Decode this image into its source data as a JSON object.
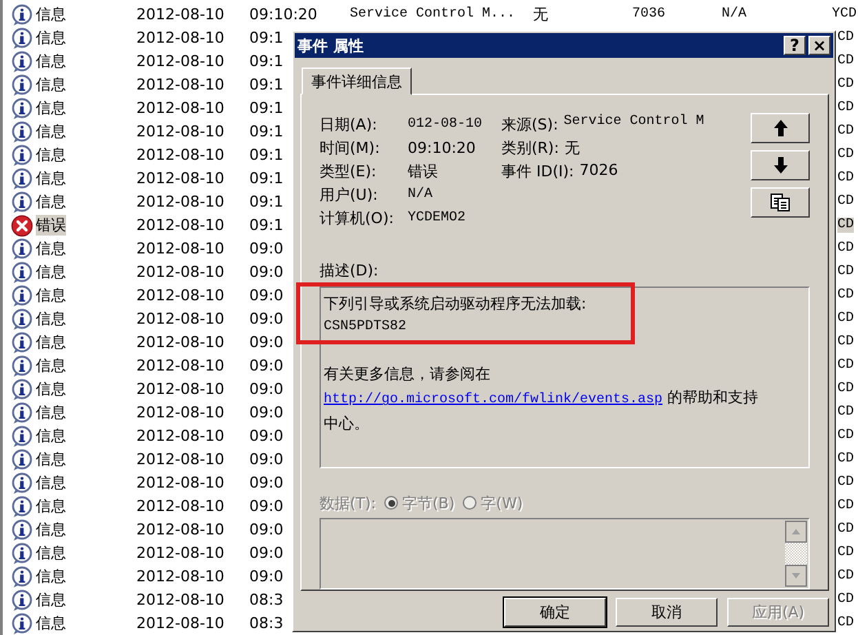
{
  "event_list": {
    "rows": [
      {
        "kind": "info",
        "type": "信息",
        "date": "2012-08-10",
        "time": "09:10:20",
        "source": "Service Control M...",
        "category": "无",
        "event_id": "7036",
        "user": "N/A",
        "computer": "YCD",
        "selected": false
      },
      {
        "kind": "info",
        "type": "信息",
        "date": "2012-08-10",
        "time": "09:1",
        "computer": "CD",
        "selected": false
      },
      {
        "kind": "info",
        "type": "信息",
        "date": "2012-08-10",
        "time": "09:1",
        "computer": "CD",
        "selected": false
      },
      {
        "kind": "info",
        "type": "信息",
        "date": "2012-08-10",
        "time": "09:1",
        "computer": "CD",
        "selected": false
      },
      {
        "kind": "info",
        "type": "信息",
        "date": "2012-08-10",
        "time": "09:1",
        "computer": "CD",
        "selected": false
      },
      {
        "kind": "info",
        "type": "信息",
        "date": "2012-08-10",
        "time": "09:1",
        "computer": "CD",
        "selected": false
      },
      {
        "kind": "info",
        "type": "信息",
        "date": "2012-08-10",
        "time": "09:1",
        "computer": "CD",
        "selected": false
      },
      {
        "kind": "info",
        "type": "信息",
        "date": "2012-08-10",
        "time": "09:1",
        "computer": "CD",
        "selected": false
      },
      {
        "kind": "info",
        "type": "信息",
        "date": "2012-08-10",
        "time": "09:1",
        "computer": "CD",
        "selected": false
      },
      {
        "kind": "error",
        "type": "错误",
        "date": "2012-08-10",
        "time": "09:1",
        "computer": "CD",
        "selected": true
      },
      {
        "kind": "info",
        "type": "信息",
        "date": "2012-08-10",
        "time": "09:0",
        "computer": "CD",
        "selected": false
      },
      {
        "kind": "info",
        "type": "信息",
        "date": "2012-08-10",
        "time": "09:0",
        "computer": "CD",
        "selected": false
      },
      {
        "kind": "info",
        "type": "信息",
        "date": "2012-08-10",
        "time": "09:0",
        "computer": "CD",
        "selected": false
      },
      {
        "kind": "info",
        "type": "信息",
        "date": "2012-08-10",
        "time": "09:0",
        "computer": "CD",
        "selected": false
      },
      {
        "kind": "info",
        "type": "信息",
        "date": "2012-08-10",
        "time": "09:0",
        "computer": "CD",
        "selected": false
      },
      {
        "kind": "info",
        "type": "信息",
        "date": "2012-08-10",
        "time": "09:0",
        "computer": "CD",
        "selected": false
      },
      {
        "kind": "info",
        "type": "信息",
        "date": "2012-08-10",
        "time": "09:0",
        "computer": "CD",
        "selected": false
      },
      {
        "kind": "info",
        "type": "信息",
        "date": "2012-08-10",
        "time": "09:0",
        "computer": "CD",
        "selected": false
      },
      {
        "kind": "info",
        "type": "信息",
        "date": "2012-08-10",
        "time": "09:0",
        "computer": "CD",
        "selected": false
      },
      {
        "kind": "info",
        "type": "信息",
        "date": "2012-08-10",
        "time": "09:0",
        "computer": "CD",
        "selected": false
      },
      {
        "kind": "info",
        "type": "信息",
        "date": "2012-08-10",
        "time": "09:0",
        "computer": "CD",
        "selected": false
      },
      {
        "kind": "info",
        "type": "信息",
        "date": "2012-08-10",
        "time": "09:0",
        "computer": "CD",
        "selected": false
      },
      {
        "kind": "info",
        "type": "信息",
        "date": "2012-08-10",
        "time": "09:0",
        "computer": "CD",
        "selected": false
      },
      {
        "kind": "info",
        "type": "信息",
        "date": "2012-08-10",
        "time": "09:0",
        "computer": "CD",
        "selected": false
      },
      {
        "kind": "info",
        "type": "信息",
        "date": "2012-08-10",
        "time": "09:0",
        "computer": "CD",
        "selected": false
      },
      {
        "kind": "info",
        "type": "信息",
        "date": "2012-08-10",
        "time": "08:3",
        "computer": "CD",
        "selected": false
      },
      {
        "kind": "info",
        "type": "信息",
        "date": "2012-08-10",
        "time": "08:3",
        "computer": "CD",
        "selected": false
      }
    ]
  },
  "dialog": {
    "title": "事件 属性",
    "help_button": "?",
    "close_button": "×",
    "tabs": [
      {
        "label": "事件详细信息",
        "selected": true
      }
    ],
    "fields": [
      {
        "label": "日期(A):",
        "value": "012-08-10",
        "label2": "来源(S):",
        "value2": "Service Control M"
      },
      {
        "label": "时间(M):",
        "value": "09:10:20",
        "label2": "类别(R):",
        "value2": "无"
      },
      {
        "label": "类型(E):",
        "value": "错误",
        "label2": "事件 ID(I):",
        "value2": "7026"
      },
      {
        "label": "用户(U):",
        "value": "N/A"
      },
      {
        "label": "计算机(O):",
        "value": "YCDEMO2"
      }
    ],
    "description": {
      "label": "描述(D):",
      "highlighted_lines": [
        "下列引导或系统启动驱动程序无法加载:",
        "CSN5PDTS82"
      ],
      "more_info": "有关更多信息，请参阅在",
      "link": "http://go.microsoft.com/fwlink/events.asp",
      "tail": "的帮助和支持中心。"
    },
    "data": {
      "label": "数据(T):",
      "disabled": true,
      "options": [
        {
          "label": "字节(B)",
          "selected": true
        },
        {
          "label": "字(W)",
          "selected": false
        }
      ]
    },
    "buttons": [
      {
        "label": "确定",
        "default": true,
        "disabled": false
      },
      {
        "label": "取消",
        "default": false,
        "disabled": false
      },
      {
        "label": "应用(A)",
        "default": false,
        "disabled": true
      }
    ]
  }
}
